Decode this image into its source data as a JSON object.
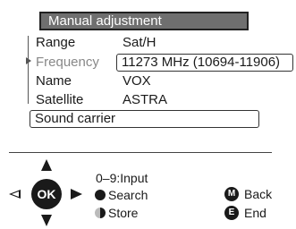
{
  "menu": {
    "title": "Manual adjustment",
    "rows": [
      {
        "label": "Range",
        "value": "Sat/H"
      },
      {
        "label": "Frequency",
        "value": "11273 MHz (10694-11906)"
      },
      {
        "label": "Name",
        "value": "VOX"
      },
      {
        "label": "Satellite",
        "value": "ASTRA"
      }
    ],
    "sound_carrier": "Sound carrier"
  },
  "controls": {
    "ok_label": "OK",
    "input_hint": "0–9:Input",
    "search_label": "Search",
    "store_label": "Store",
    "back_key": "M",
    "back_label": "Back",
    "end_key": "E",
    "end_label": "End"
  }
}
